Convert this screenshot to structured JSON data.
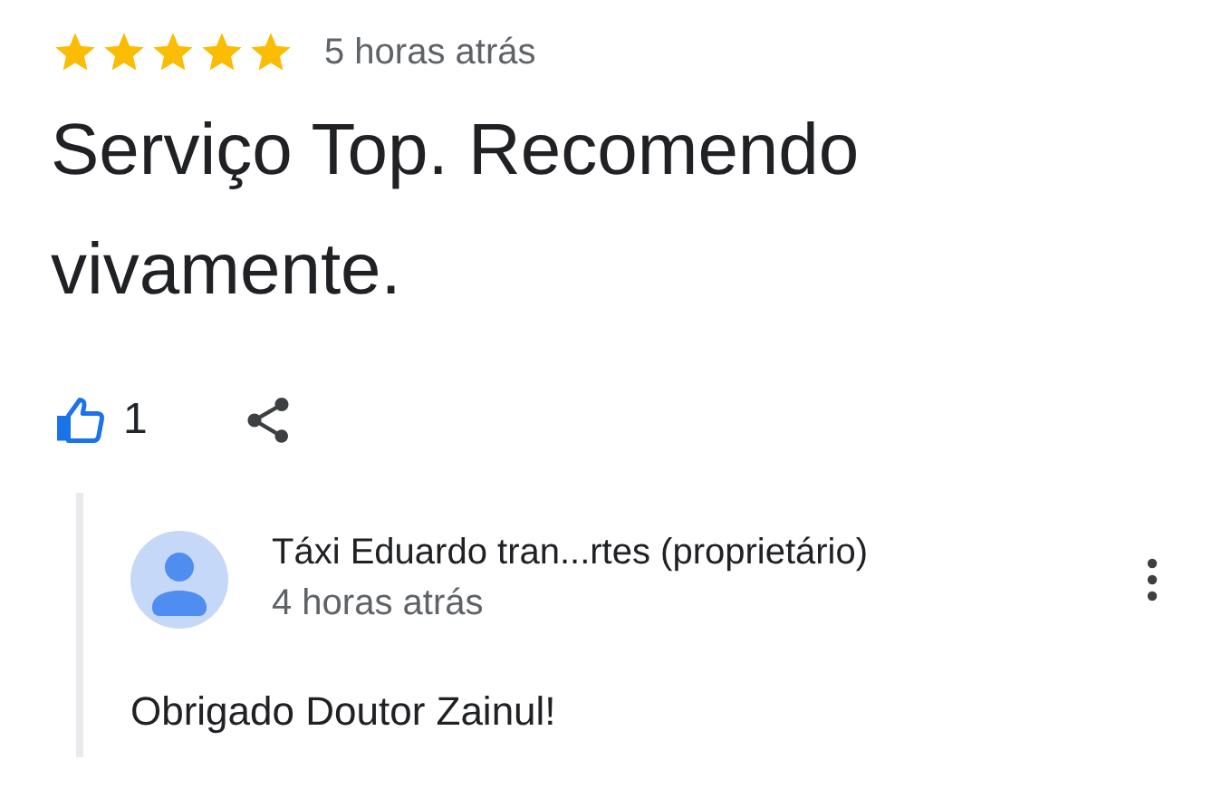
{
  "review": {
    "stars": 5,
    "time": "5 horas atrás",
    "text": "Serviço Top. Recomendo vivamente.",
    "likes": "1",
    "liked": true
  },
  "reply": {
    "author": "Táxi Eduardo tran...rtes (proprietário)",
    "time": "4 horas atrás",
    "text": "Obrigado Doutor Zainul!"
  }
}
